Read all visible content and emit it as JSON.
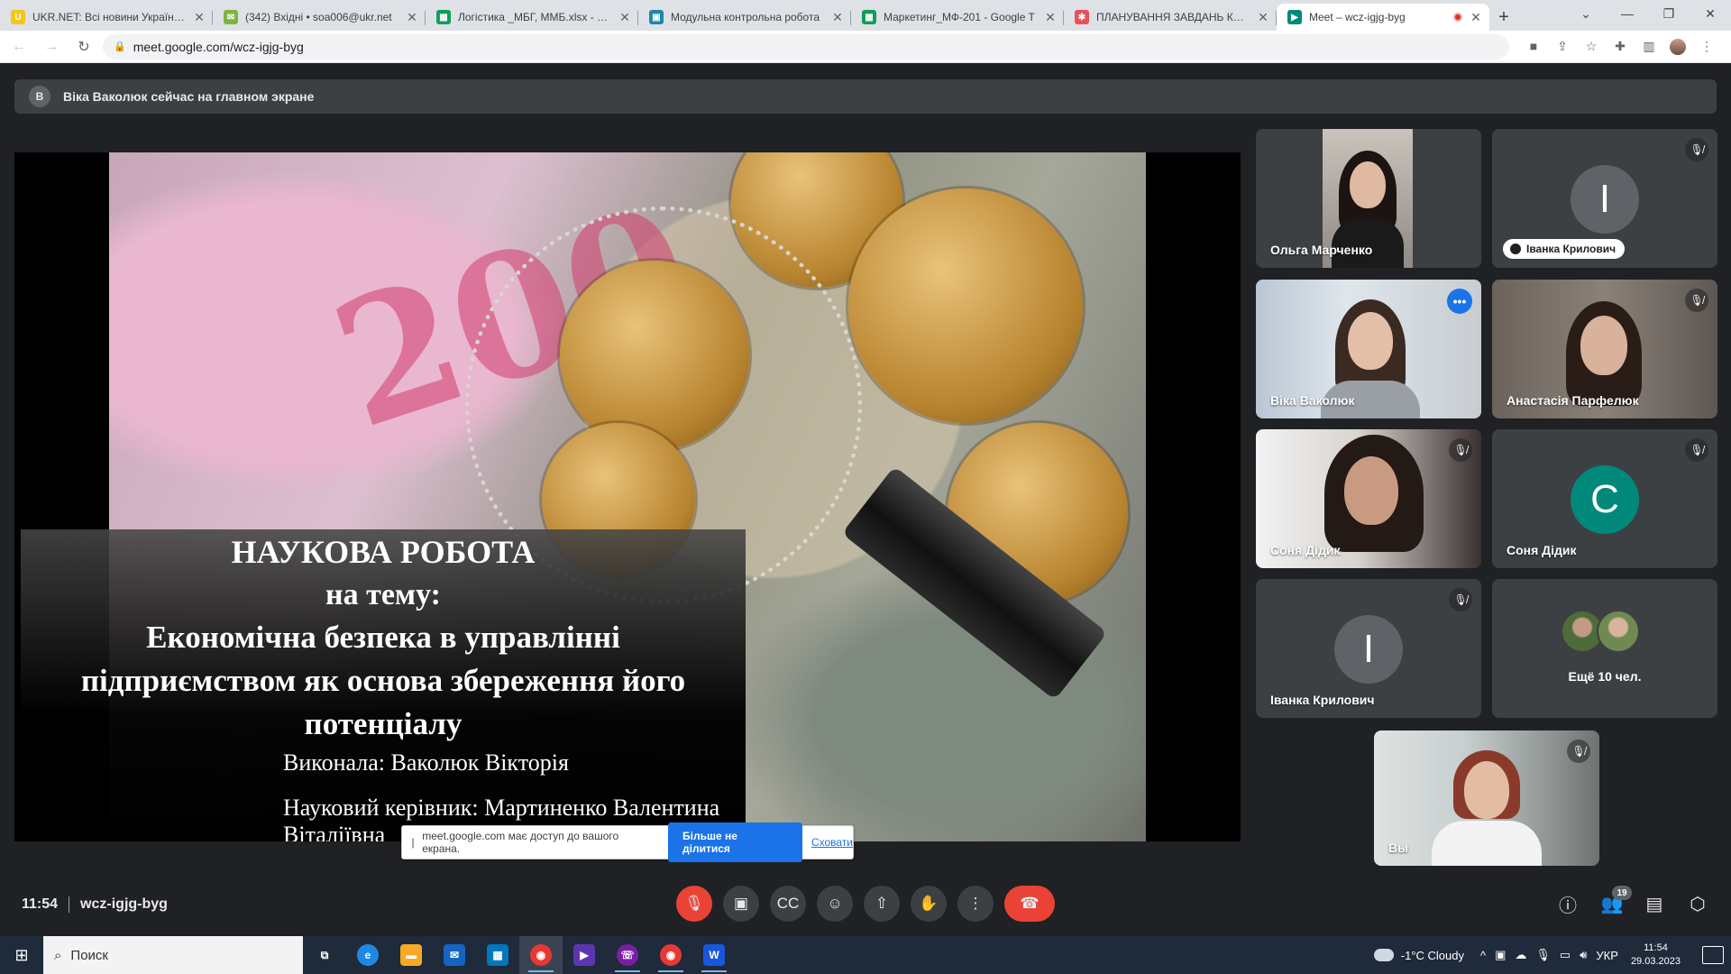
{
  "browser": {
    "tabs": [
      {
        "title": "UKR.NET: Всі новини України, о",
        "fav_color": "#f5c518",
        "fav_glyph": "U"
      },
      {
        "title": "(342) Вхідні • soa006@ukr.net",
        "fav_color": "#7cb342",
        "fav_glyph": "✉"
      },
      {
        "title": "Логістика _МБГ, ММБ.xlsx - Goo",
        "fav_color": "#0f9d58",
        "fav_glyph": "▦"
      },
      {
        "title": "Модульна контрольна робота",
        "fav_color": "#1e88a8",
        "fav_glyph": "▣"
      },
      {
        "title": "Маркетинг_МФ-201 - Google T",
        "fav_color": "#0f9d58",
        "fav_glyph": "▦"
      },
      {
        "title": "ПЛАНУВАННЯ ЗАВДАНЬ КАФЕ",
        "fav_color": "#e8505b",
        "fav_glyph": "✱"
      },
      {
        "title": "Meet – wcz-igjg-byg",
        "fav_color": "#00897b",
        "fav_glyph": "▶"
      }
    ],
    "url": "meet.google.com/wcz-igjg-byg"
  },
  "meet": {
    "banner_initial": "В",
    "banner_text": "Віка Ваколюк сейчас на главном экране",
    "slide": {
      "title1": "НАУКОВА РОБОТА",
      "title2": "на тему:",
      "title3": "Економічна безпека в управлінні підприємством як основа збереження його потенціалу",
      "author": "Виконала: Ваколюк Вікторія",
      "supervisor": "Науковий керівник: Мартиненко Валентина Віталіївна"
    },
    "share_notice": {
      "text": "meet.google.com має доступ до вашого екрана.",
      "stop_label": "Більше не ділитися",
      "hide_label": "Сховати"
    },
    "participants": [
      {
        "name": "Ольга Марченко",
        "type": "video"
      },
      {
        "name": "Іванка Крилович",
        "type": "avatar",
        "initial": "I",
        "color": "#5f6368",
        "muted": true
      },
      {
        "name": "Віка Ваколюк",
        "type": "video",
        "active": true
      },
      {
        "name": "Анастасія Парфелюк",
        "type": "video",
        "muted": true
      },
      {
        "name": "Соня Дідик",
        "type": "video",
        "muted": true
      },
      {
        "name": "Соня Дідик",
        "type": "avatar",
        "initial": "C",
        "color": "#00897b",
        "muted": true
      },
      {
        "name": "Іванка Крилович",
        "type": "avatar",
        "initial": "I",
        "color": "#5f6368",
        "muted": true
      }
    ],
    "more_label": "Ещё 10 чел.",
    "self_label": "Вы",
    "time": "11:54",
    "meeting_code": "wcz-igjg-byg",
    "people_count": "19"
  },
  "taskbar": {
    "search_placeholder": "Поиск",
    "weather": "-1°C  Cloudy",
    "lang": "УКР",
    "time": "11:54",
    "date": "29.03.2023",
    "apps": [
      {
        "name": "task-view",
        "color": "#1f2a3a",
        "glyph": "⧉"
      },
      {
        "name": "edge",
        "color": "#1e88e5",
        "glyph": "e"
      },
      {
        "name": "file-explorer",
        "color": "#f9a825",
        "glyph": "▬"
      },
      {
        "name": "mail",
        "color": "#1565c0",
        "glyph": "✉"
      },
      {
        "name": "store",
        "color": "#0277bd",
        "glyph": "▦"
      },
      {
        "name": "chrome",
        "color": "#e53935",
        "glyph": "◉"
      },
      {
        "name": "media-player",
        "color": "#5e35b1",
        "glyph": "▶"
      },
      {
        "name": "viber",
        "color": "#7b1fa2",
        "glyph": "☏"
      },
      {
        "name": "chrome-profile",
        "color": "#e53935",
        "glyph": "◉"
      },
      {
        "name": "word",
        "color": "#1a56db",
        "glyph": "W"
      }
    ]
  }
}
